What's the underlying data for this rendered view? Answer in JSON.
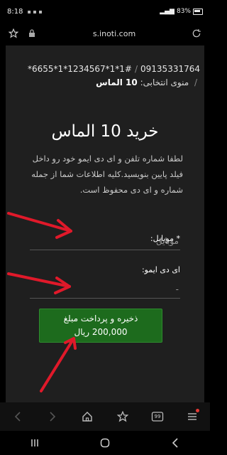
{
  "status_bar": {
    "time": "8:18",
    "battery_percent": "83%"
  },
  "url_bar": {
    "url": "s.inoti.com"
  },
  "breadcrumb": {
    "code": "*6655*1*1234567*1*1#",
    "phone": "09135331764",
    "menu_label": "منوی انتخابی:",
    "menu_value": "10 الماس"
  },
  "form": {
    "title": "خرید 10 الماس",
    "description": "لطفا شماره تلفن و ای دی ایمو خود رو داخل فیلد پایین بنویسید.کلیه اطلاعات شما از جمله شماره و ای دی محفوظ است.",
    "mobile_label": "* موبایل:",
    "mobile_placeholder": "موبایل",
    "imo_label": "ای دی ایمو:",
    "imo_placeholder": "-",
    "submit_label": "ذخیره و پرداخت مبلغ 200,000 ریال",
    "submit_color": "#1d6b1d"
  },
  "annotation": {
    "arrow_color": "#e0192a"
  },
  "browser_nav": {
    "tabs_count": "99"
  }
}
